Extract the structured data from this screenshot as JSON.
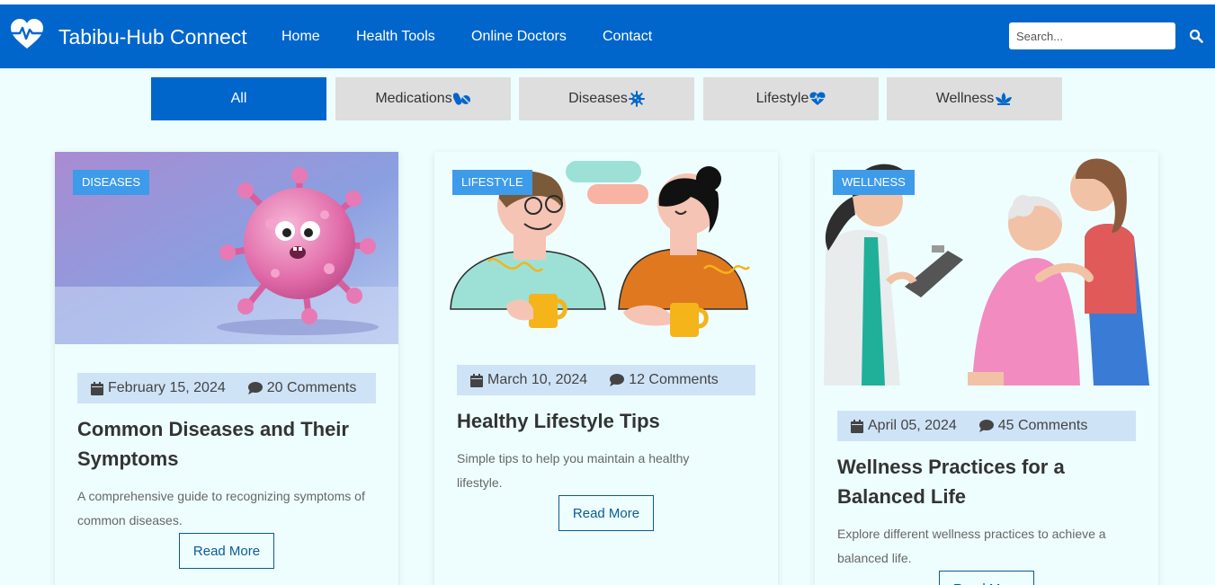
{
  "brand": {
    "title": "Tabibu-Hub Connect",
    "icon": "heart-pulse-icon"
  },
  "nav": {
    "links": [
      "Home",
      "Health Tools",
      "Online Doctors",
      "Contact"
    ]
  },
  "search": {
    "placeholder": "Search...",
    "icon": "search-icon"
  },
  "filters": [
    {
      "label": "All",
      "active": true
    },
    {
      "label": "Medications",
      "icon": "pills-icon"
    },
    {
      "label": "Diseases",
      "icon": "virus-icon"
    },
    {
      "label": "Lifestyle",
      "icon": "heart-pulse-icon"
    },
    {
      "label": "Wellness",
      "icon": "lotus-icon"
    }
  ],
  "cards": [
    {
      "badge": "DISEASES",
      "date": "February 15, 2024",
      "comments": "20 Comments",
      "title": "Common Diseases and Their Symptoms",
      "description": "A comprehensive guide to recognizing symptoms of common diseases.",
      "button": "Read More"
    },
    {
      "badge": "LIFESTYLE",
      "date": "March 10, 2024",
      "comments": "12 Comments",
      "title": "Healthy Lifestyle Tips",
      "description": "Simple tips to help you maintain a healthy lifestyle.",
      "button": "Read More"
    },
    {
      "badge": "WELLNESS",
      "date": "April 05, 2024",
      "comments": "45 Comments",
      "title": "Wellness Practices for a Balanced Life",
      "description": "Explore different wellness practices to achieve a balanced life.",
      "button": "Read More"
    }
  ],
  "colors": {
    "primary": "#0066cc",
    "badge": "#3d9bea",
    "meta_bg": "#cfe3f7",
    "page_bg": "#eefefe"
  }
}
